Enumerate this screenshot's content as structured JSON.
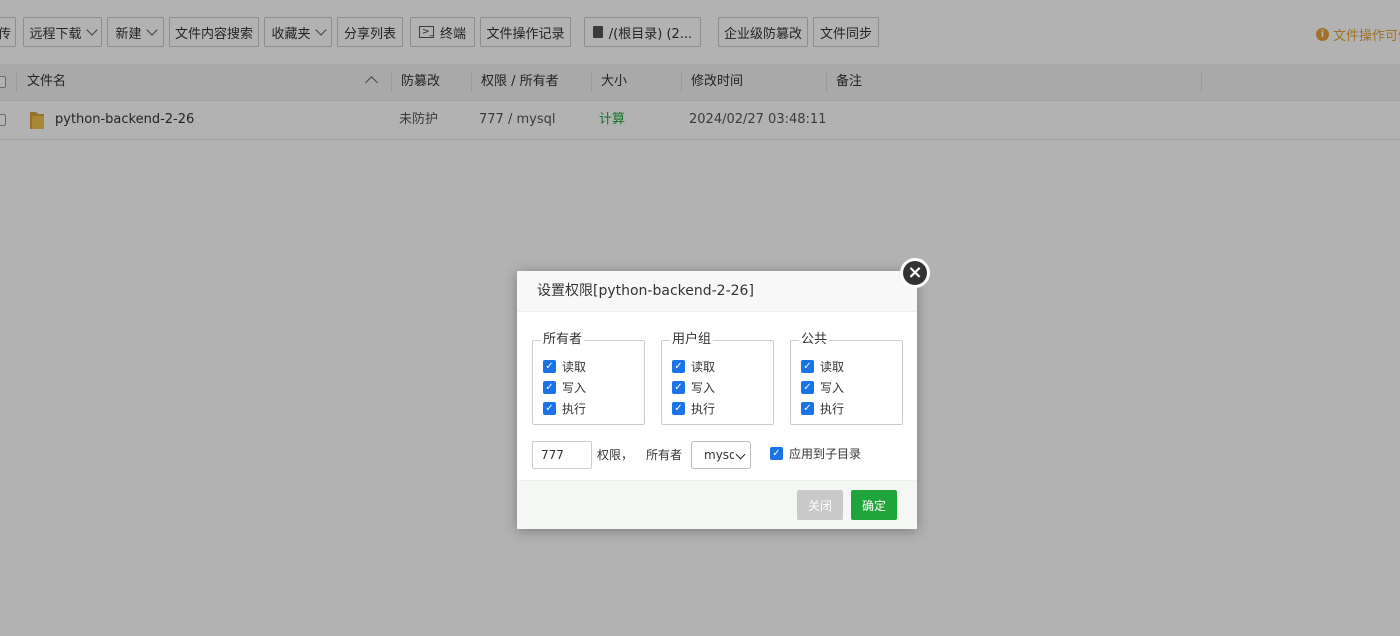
{
  "toolbar": {
    "items": [
      "传",
      "远程下载",
      "新建",
      "文件内容搜索",
      "收藏夹",
      "分享列表",
      "终端",
      "文件操作记录",
      "/(根目录) (2...",
      "企业级防篡改",
      "文件同步"
    ],
    "warning": "文件操作可倒"
  },
  "table": {
    "headers": [
      "文件名",
      "防篡改",
      "权限 / 所有者",
      "大小",
      "修改时间",
      "备注"
    ],
    "rows": [
      {
        "name": "python-backend-2-26",
        "tamper": "未防护",
        "perm": "777 / mysql",
        "size": "计算",
        "mtime": "2024/02/27 03:48:11",
        "note": ""
      }
    ]
  },
  "colors": {
    "size_link": "#20a53a",
    "warning": "#e6a23c",
    "ok_button": "#20a53a",
    "checkbox": "#1a73e8"
  },
  "dialog": {
    "title": "设置权限[python-backend-2-26]",
    "groups": [
      {
        "label": "所有者",
        "options": [
          "读取",
          "写入",
          "执行"
        ]
      },
      {
        "label": "用户组",
        "options": [
          "读取",
          "写入",
          "执行"
        ]
      },
      {
        "label": "公共",
        "options": [
          "读取",
          "写入",
          "执行"
        ]
      }
    ],
    "perm_value": "777",
    "perm_label": "权限，",
    "owner_label": "所有者",
    "owner_value": "mysql",
    "apply_label": "应用到子目录",
    "close_label": "关闭",
    "ok_label": "确定",
    "close_icon": "×"
  }
}
